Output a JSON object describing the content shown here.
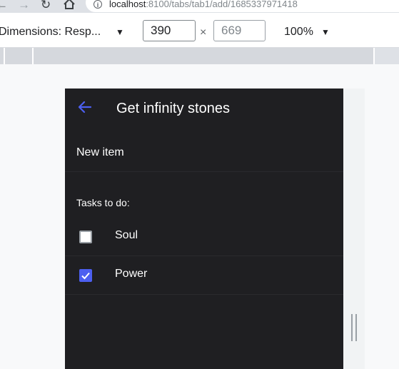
{
  "browser": {
    "url_host": "localhost",
    "url_path": ":8100/tabs/tab1/add/1685337971418"
  },
  "device_toolbar": {
    "dimensions_label": "Dimensions: Resp...",
    "width": "390",
    "height_placeholder": "669",
    "times": "×",
    "zoom": "100%"
  },
  "app": {
    "title": "Get infinity stones",
    "new_item_placeholder": "New item",
    "tasks_label": "Tasks to do:",
    "tasks": [
      {
        "label": "Soul",
        "checked": false
      },
      {
        "label": "Power",
        "checked": true
      }
    ],
    "accent_color": "#4c5ff0",
    "background_color": "#1f1f22"
  }
}
